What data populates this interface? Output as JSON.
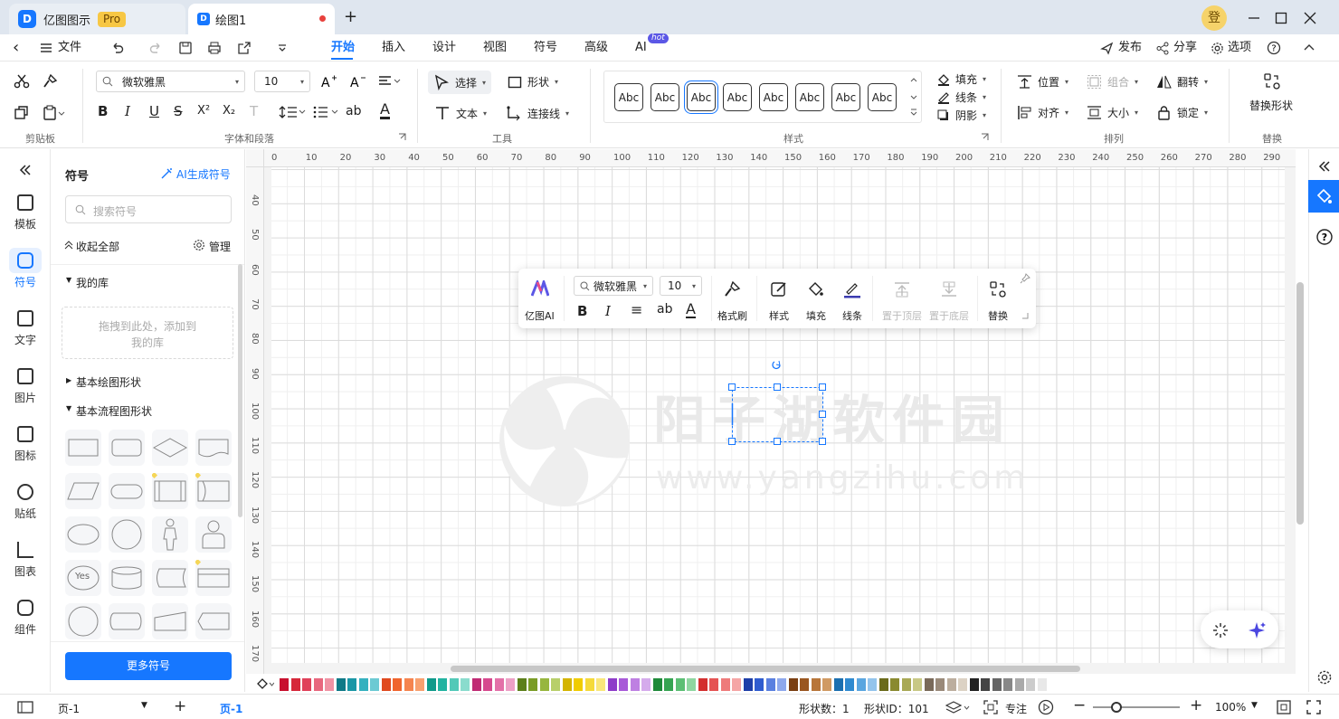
{
  "titlebar": {
    "app_name": "亿图图示",
    "pro_label": "Pro",
    "doc_tab": "绘图1",
    "new_tab": "+",
    "user_initial": "登"
  },
  "menubar": {
    "back": "‹",
    "file": "文件",
    "tabs": [
      "开始",
      "插入",
      "设计",
      "视图",
      "符号",
      "高级",
      "AI"
    ],
    "ai_badge": "hot",
    "publish": "发布",
    "share": "分享",
    "options": "选项"
  },
  "ribbon": {
    "groups": [
      "剪贴板",
      "字体和段落",
      "工具",
      "样式",
      "排列",
      "替换"
    ],
    "font_name": "微软雅黑",
    "font_size": "10",
    "select": "选择",
    "shape": "形状",
    "text": "文本",
    "connector": "连接线",
    "styles": [
      "Abc",
      "Abc",
      "Abc",
      "Abc",
      "Abc",
      "Abc",
      "Abc",
      "Abc"
    ],
    "fill": "填充",
    "line": "线条",
    "shadow": "阴影",
    "position": "位置",
    "group": "组合",
    "flip": "翻转",
    "align": "对齐",
    "size": "大小",
    "lock": "锁定",
    "replace_shape": "替换形状",
    "format_glyphs": [
      "B",
      "I",
      "U",
      "S",
      "X²",
      "X₂",
      "T",
      "ab",
      "A"
    ]
  },
  "leftbar": {
    "items": [
      "模板",
      "符号",
      "文字",
      "图片",
      "图标",
      "贴纸",
      "图表",
      "组件"
    ]
  },
  "panel": {
    "title": "符号",
    "ai_generate": "AI生成符号",
    "search_placeholder": "搜索符号",
    "collapse_all": "收起全部",
    "manage": "管理",
    "my_library": "我的库",
    "drop_hint_line1": "拖拽到此处，添加到",
    "drop_hint_line2": "我的库",
    "basic_shapes": "基本绘图形状",
    "flowchart_shapes": "基本流程图形状",
    "yes_label": "Yes",
    "more_symbols": "更多符号"
  },
  "ruler": {
    "x": [
      "0",
      "10",
      "20",
      "30",
      "40",
      "50",
      "60",
      "70",
      "80",
      "90",
      "100",
      "110",
      "120",
      "130",
      "140",
      "150",
      "160",
      "170",
      "180",
      "190",
      "200",
      "210",
      "220",
      "230",
      "240",
      "250",
      "260",
      "270",
      "280",
      "290"
    ],
    "y": [
      "40",
      "50",
      "60",
      "70",
      "80",
      "90",
      "100",
      "110",
      "120",
      "130",
      "140",
      "150",
      "160",
      "170"
    ]
  },
  "floating_toolbar": {
    "ai": "亿图AI",
    "font_name": "微软雅黑",
    "font_size": "10",
    "format_painter": "格式刷",
    "style": "样式",
    "fill": "填充",
    "line": "线条",
    "bring_front": "置于顶层",
    "send_back": "置于底层",
    "replace": "替换",
    "glyphs": [
      "B",
      "I",
      "≡",
      "ab",
      "A"
    ]
  },
  "watermark": {
    "text": "阳子湖软件园",
    "url": "www.yangzihu.com"
  },
  "palette": [
    "#c8102e",
    "#d6283a",
    "#e0415a",
    "#e8677e",
    "#f093a4",
    "#0f7a87",
    "#1a97a6",
    "#35b1bf",
    "#6ccad3",
    "#e04a1f",
    "#f0652e",
    "#f5844f",
    "#f8a06f",
    "#0f9a8a",
    "#22b3a0",
    "#52c9b8",
    "#8adccd",
    "#c02b74",
    "#d6498e",
    "#e370a8",
    "#eda0c6",
    "#5c7f1a",
    "#7a9c26",
    "#97b63e",
    "#b8cf6a",
    "#d4b400",
    "#f0cc00",
    "#f5da3a",
    "#f9e77b",
    "#8e3cc9",
    "#a85ad8",
    "#be80e2",
    "#d5abec",
    "#1f8a3a",
    "#36a452",
    "#5cbf74",
    "#8ed6a0",
    "#d32f2f",
    "#e55353",
    "#ee7b7b",
    "#f5a5a5",
    "#1e3fa8",
    "#2f5ccf",
    "#5a80e0",
    "#8ea8ec",
    "#7a3f12",
    "#9a5620",
    "#b8763a",
    "#d09a63",
    "#1b6fb0",
    "#2f8ad0",
    "#5aa6e0",
    "#93c4ec",
    "#6a6a1a",
    "#8a8a30",
    "#a9a955",
    "#c8c885",
    "#7a6a5a",
    "#9a8a7a",
    "#bcae9e",
    "#dcd2c4",
    "#222222",
    "#444444",
    "#666666",
    "#888888",
    "#aaaaaa",
    "#cccccc",
    "#e8e8e8"
  ],
  "statusbar": {
    "page_selector": "页-1",
    "page_tab": "页-1",
    "shape_count": "形状数：1",
    "shape_id": "形状ID：101",
    "focus": "专注",
    "zoom": "100%"
  }
}
